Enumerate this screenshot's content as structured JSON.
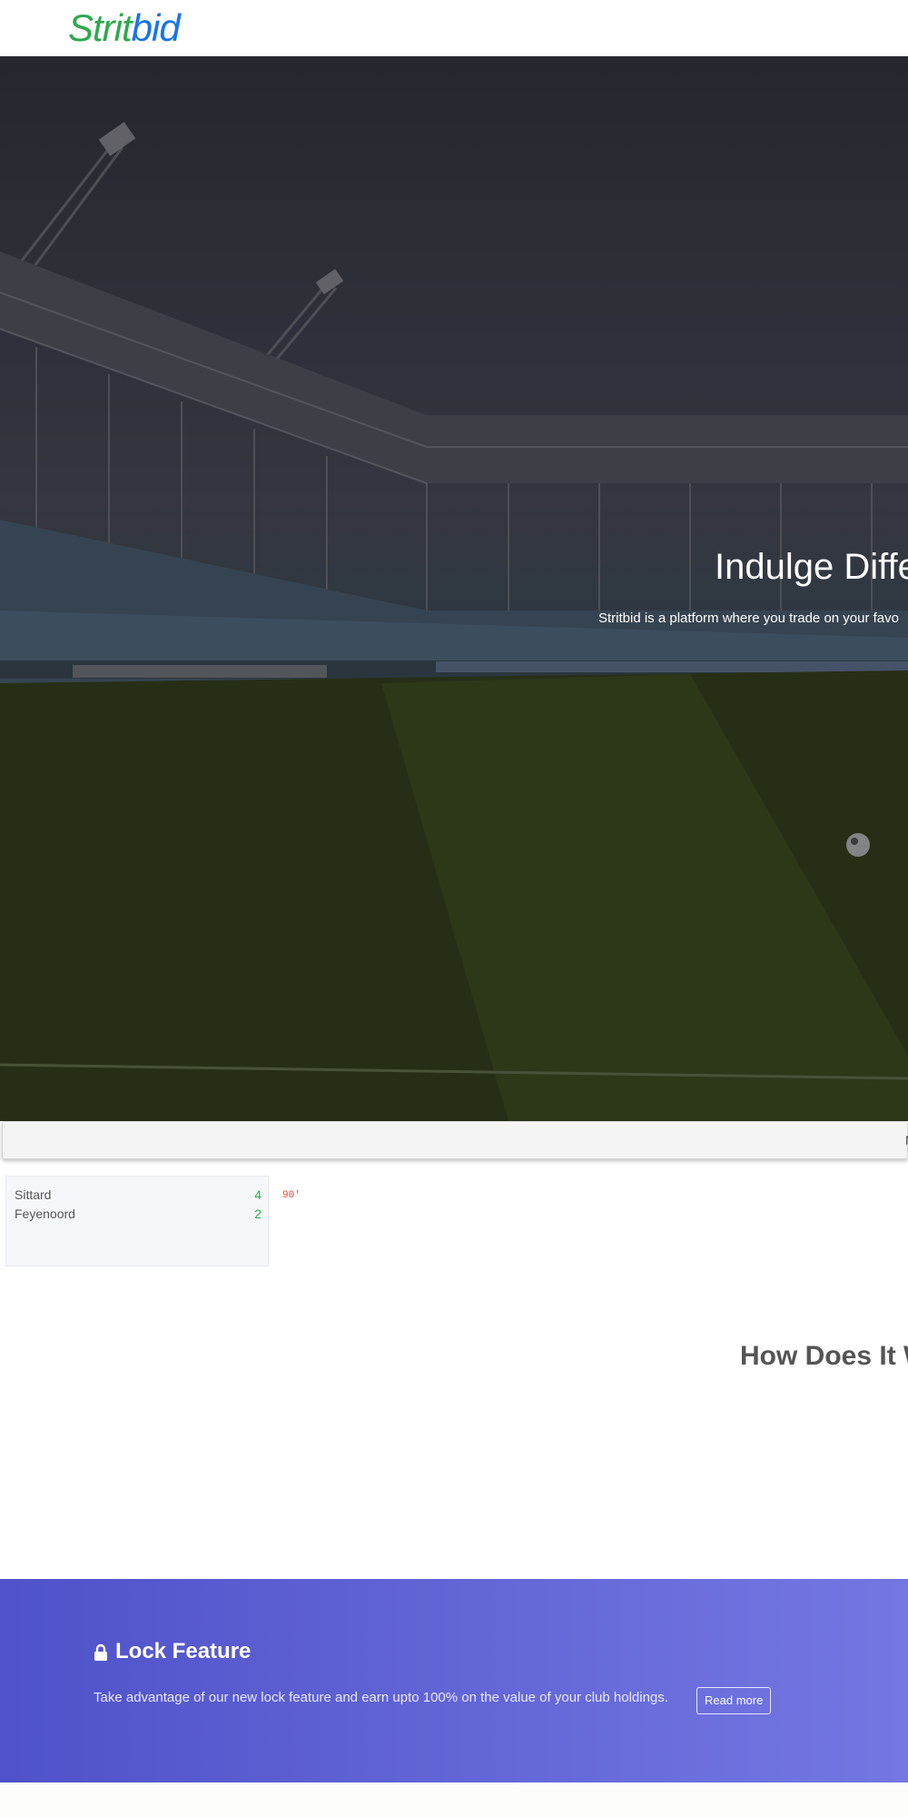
{
  "brand": {
    "logo_part1": "Strit",
    "logo_part2": "bid"
  },
  "hero": {
    "title": "Indulge Diffe",
    "subtitle": "Stritbid is a platform where you trade on your favo"
  },
  "ticker": {
    "text": "N"
  },
  "match": {
    "home_team": "Sittard",
    "home_score": "4",
    "away_team": "Feyenoord",
    "away_score": "2",
    "minute": "90'"
  },
  "how": {
    "title": "How Does It W"
  },
  "lock": {
    "title": "Lock Feature",
    "text": "Take advantage of our new lock feature and earn upto 100% on the value of your club holdings.",
    "button": "Read more"
  },
  "colors": {
    "brand_green": "#2fa84f",
    "brand_blue": "#1a73e8",
    "score_green": "#2fa84f",
    "minute_red": "#e0443a",
    "lock_gradient_start": "#4f52c8",
    "lock_gradient_end": "#7477e2"
  }
}
